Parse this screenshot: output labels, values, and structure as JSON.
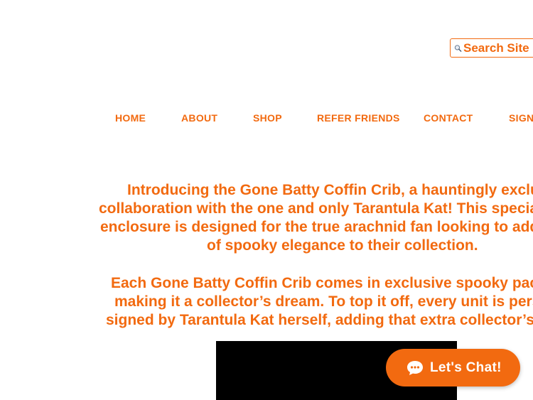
{
  "search": {
    "placeholder": "Search Site",
    "icon": "search-icon"
  },
  "nav": {
    "items": [
      {
        "label": "HOME"
      },
      {
        "label": "ABOUT"
      },
      {
        "label": "SHOP"
      },
      {
        "label": "REFER FRIENDS"
      },
      {
        "label": "CONTACT"
      },
      {
        "label": "SIGN"
      }
    ]
  },
  "intro": {
    "paragraph_1": {
      "line_1": "Introducing the Gone Batty Coffin Crib, a hauntingly exclusiv",
      "line_2": "collaboration with the one and only Tarantula Kat! This special e",
      "line_3": "enclosure is designed for the true arachnid fan looking to add a",
      "line_4": "of spooky elegance to their collection."
    },
    "paragraph_2": {
      "line_1": "Each Gone Batty Coffin Crib comes in exclusive spooky packag",
      "line_2": "making it a collector’s dream. To top it off, every unit is person",
      "line_3": "signed by Tarantula Kat herself, adding that extra collector’s v"
    }
  },
  "chat": {
    "label": "Let's Chat!",
    "icon": "chat-bubble-icon"
  },
  "colors": {
    "accent": "#f26a10",
    "video_background": "#000000",
    "page_background": "#ffffff"
  }
}
